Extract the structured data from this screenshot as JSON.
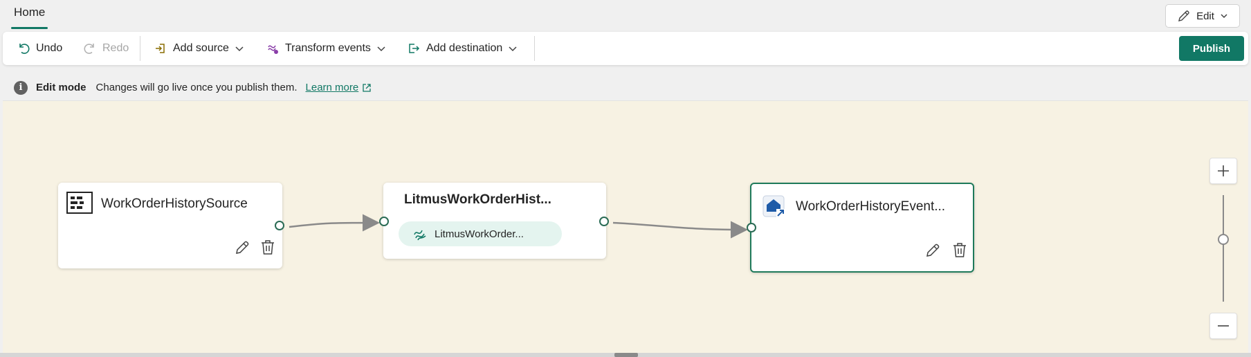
{
  "tabs": {
    "home": "Home"
  },
  "edit_menu": {
    "label": "Edit"
  },
  "toolbar": {
    "undo": "Undo",
    "redo": "Redo",
    "add_source": "Add source",
    "transform_events": "Transform events",
    "add_destination": "Add destination",
    "publish": "Publish"
  },
  "infobar": {
    "title": "Edit mode",
    "message": "Changes will go live once you publish them.",
    "link": "Learn more"
  },
  "nodes": {
    "source": {
      "title": "WorkOrderHistorySource"
    },
    "stream": {
      "title": "LitmusWorkOrderHist...",
      "chip": "LitmusWorkOrder..."
    },
    "destination": {
      "title": "WorkOrderHistoryEvent..."
    }
  },
  "colors": {
    "accent": "#117865",
    "canvas": "#f7f2e3",
    "chip": "#e4f4ef"
  },
  "icons": [
    "undo-icon",
    "redo-icon",
    "add-source-icon",
    "transform-icon",
    "add-destination-icon",
    "chevron-down-icon",
    "pencil-icon",
    "info-icon",
    "external-link-icon",
    "source-grid-icon",
    "stream-icon",
    "eventhouse-icon",
    "delete-icon",
    "zoom-in-icon",
    "zoom-out-icon"
  ]
}
